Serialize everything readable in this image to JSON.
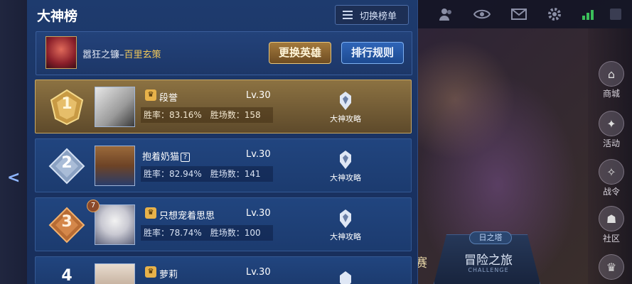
{
  "panel": {
    "title": "大神榜",
    "switch_label": "切换榜单"
  },
  "hero": {
    "name_prefix": "嚣狂之镰–",
    "name_hero": "百里玄策",
    "change_button": "更换英雄",
    "rule_button": "排行规则"
  },
  "rows": [
    {
      "rank": "1",
      "name": "段誉",
      "level": "Lv.30",
      "win_rate": "胜率：83.16%",
      "wins": "胜场数：158",
      "strategy": "大神攻略"
    },
    {
      "rank": "2",
      "name": "抱着奶猫",
      "level": "Lv.30",
      "win_rate": "胜率：82.94%",
      "wins": "胜场数：141",
      "strategy": "大神攻略"
    },
    {
      "rank": "3",
      "name": "只想宠着思思",
      "level": "Lv.30",
      "win_rate": "胜率：78.74%",
      "wins": "胜场数：100",
      "strategy": "大神攻略",
      "badge": "7"
    },
    {
      "rank": "4",
      "name": "萝莉",
      "level": "Lv.30",
      "win_rate": "",
      "wins": "",
      "strategy": ""
    }
  ],
  "side_menu": {
    "shop": "商城",
    "event": "活动",
    "battle_pass": "战令",
    "community": "社区"
  },
  "adventure": {
    "tag": "日之塔",
    "title": "冒险之旅",
    "subtitle": "CHALLENGE",
    "partial": "赛"
  },
  "colors": {
    "panel_bg": "#1e3b6e",
    "gold_row": "#8c7242",
    "gold_text": "#f0c85a"
  }
}
